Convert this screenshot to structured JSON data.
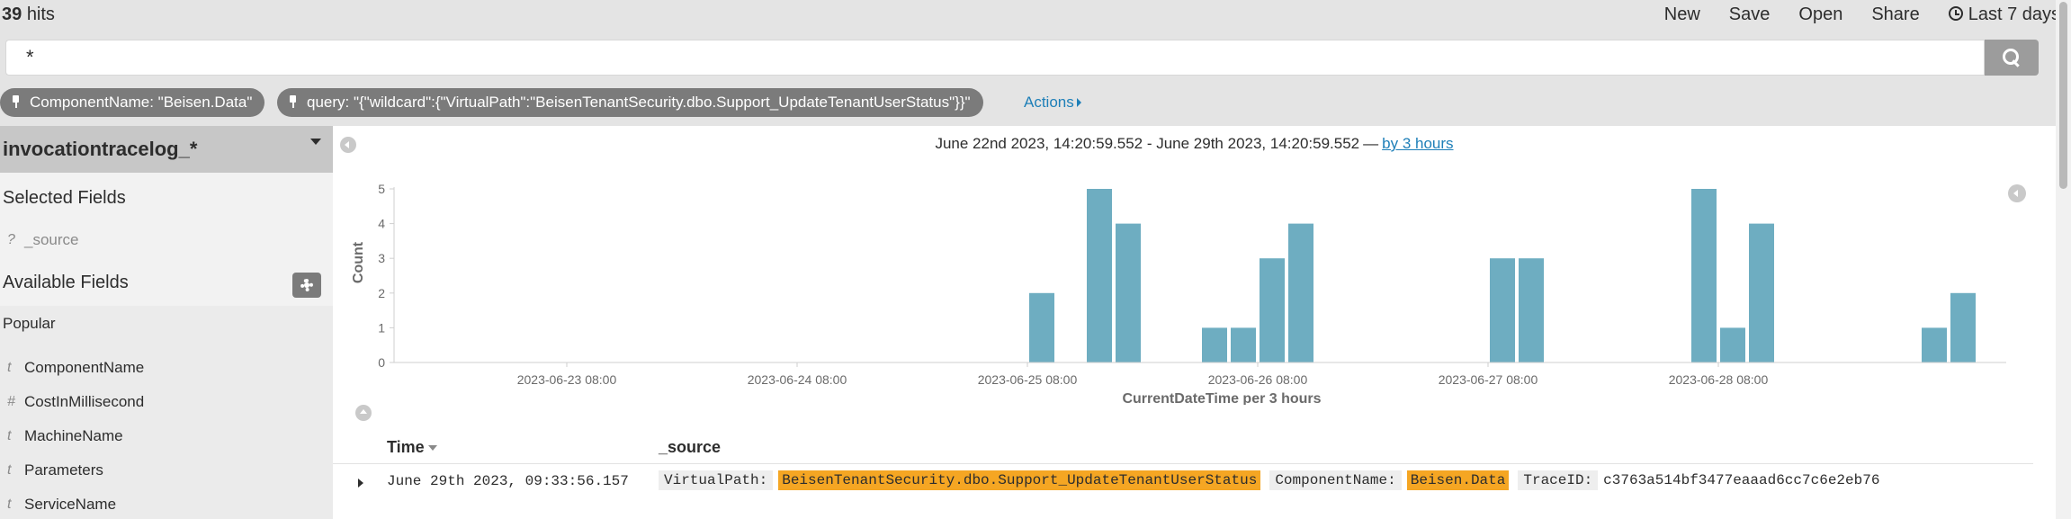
{
  "header": {
    "hit_count": "39",
    "hits_label": "hits",
    "nav": {
      "new": "New",
      "save": "Save",
      "open": "Open",
      "share": "Share",
      "time_range": "Last 7 days"
    }
  },
  "query": {
    "value": "*"
  },
  "filters": [
    {
      "label": "ComponentName: \"Beisen.Data\""
    },
    {
      "label": "query: \"{\"wildcard\":{\"VirtualPath\":\"BeisenTenantSecurity.dbo.Support_UpdateTenantUserStatus\"}}\""
    }
  ],
  "actions_label": "Actions",
  "sidebar": {
    "index_pattern": "invocationtracelog_*",
    "selected_title": "Selected Fields",
    "selected_fields": [
      {
        "type": "?",
        "name": "_source"
      }
    ],
    "available_title": "Available Fields",
    "popular_title": "Popular",
    "popular_fields": [
      {
        "type": "t",
        "name": "ComponentName"
      },
      {
        "type": "#",
        "name": "CostInMillisecond"
      },
      {
        "type": "t",
        "name": "MachineName"
      },
      {
        "type": "t",
        "name": "Parameters"
      },
      {
        "type": "t",
        "name": "ServiceName"
      }
    ]
  },
  "histogram": {
    "range_text": "June 22nd 2023, 14:20:59.552 - June 29th 2023, 14:20:59.552",
    "range_sep": "—",
    "interval_link": "by 3 hours"
  },
  "chart_data": {
    "type": "bar",
    "title": "",
    "xlabel": "CurrentDateTime per 3 hours",
    "ylabel": "Count",
    "ylim": [
      0,
      5
    ],
    "y_ticks": [
      0,
      1,
      2,
      3,
      4,
      5
    ],
    "x_ticks": [
      "2023-06-23 08:00",
      "2023-06-24 08:00",
      "2023-06-25 08:00",
      "2023-06-26 08:00",
      "2023-06-27 08:00",
      "2023-06-28 08:00"
    ],
    "bar_color": "#6eadc1",
    "x": [
      "2023-06-25 08:00",
      "2023-06-25 14:00",
      "2023-06-25 17:00",
      "2023-06-26 02:00",
      "2023-06-26 05:00",
      "2023-06-26 08:00",
      "2023-06-26 11:00",
      "2023-06-27 08:00",
      "2023-06-27 11:00",
      "2023-06-28 05:00",
      "2023-06-28 08:00",
      "2023-06-28 11:00",
      "2023-06-29 05:00",
      "2023-06-29 08:00"
    ],
    "values": [
      2,
      5,
      4,
      1,
      1,
      3,
      4,
      3,
      3,
      5,
      1,
      4,
      1,
      2
    ]
  },
  "table": {
    "time_header": "Time",
    "source_header": "_source",
    "rows": [
      {
        "time": "June 29th 2023, 09:33:56.157",
        "vp_key": "VirtualPath:",
        "vp_val": "BeisenTenantSecurity.dbo.Support_UpdateTenantUserStatus",
        "cn_key": "ComponentName:",
        "cn_val": "Beisen.Data",
        "tr_key": "TraceID:",
        "tr_val": "c3763a514bf3477eaaad6cc7c6e2eb76"
      }
    ]
  },
  "colors": {
    "accent": "#1e7fb8",
    "highlight": "#f5a623",
    "bar": "#6eadc1",
    "pill": "#7b7b7b"
  }
}
